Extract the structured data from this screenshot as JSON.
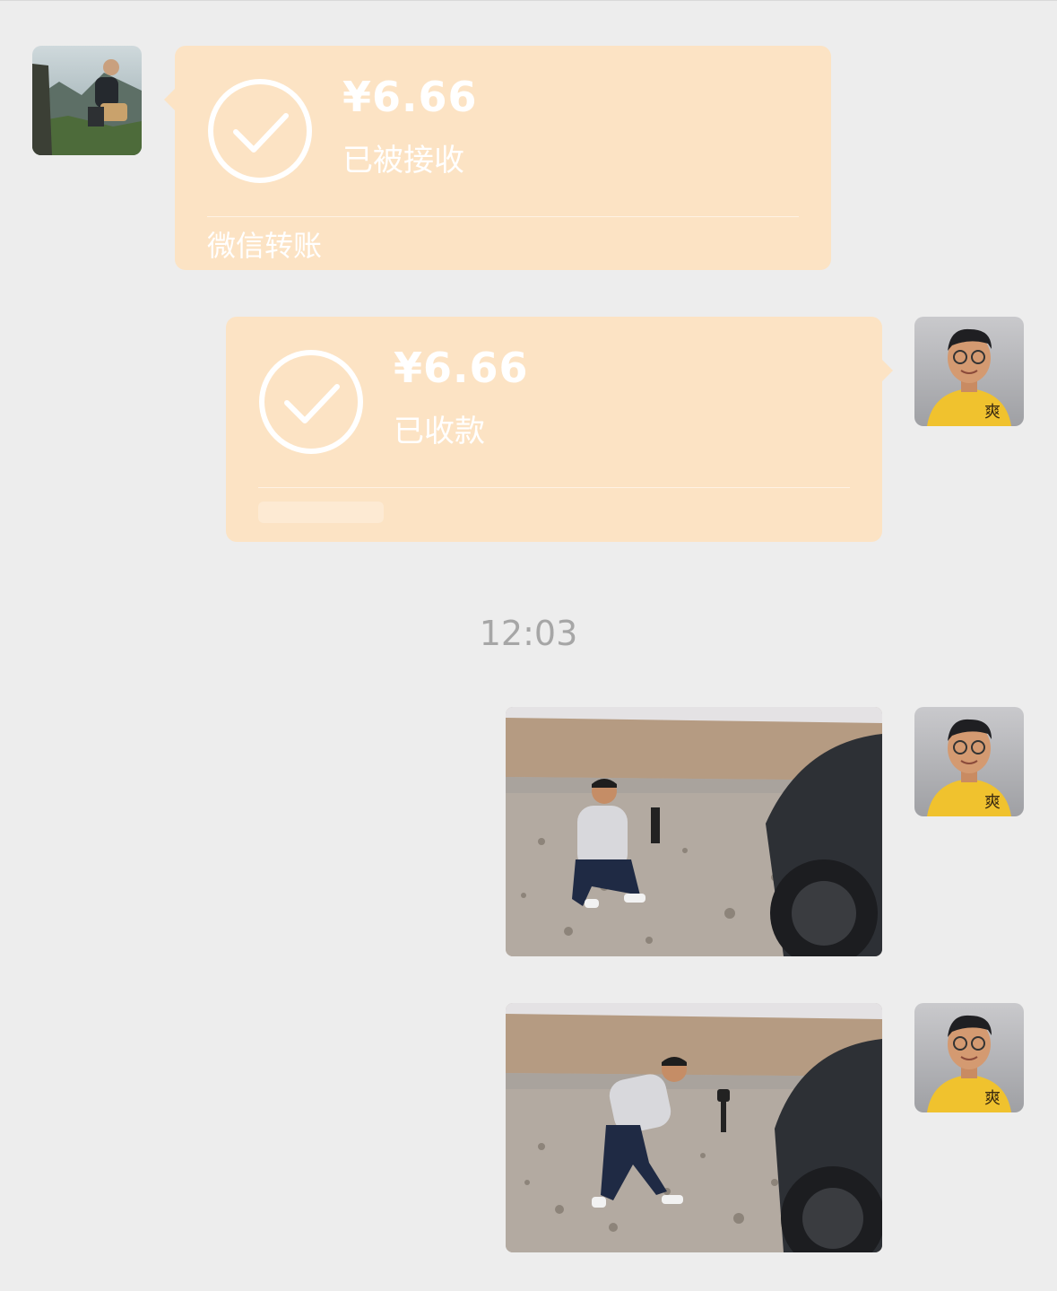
{
  "messages": [
    {
      "type": "transfer",
      "side": "left",
      "amount": "¥6.66",
      "status": "已被接收",
      "footer": "微信转账",
      "icon": "check-circle-icon"
    },
    {
      "type": "transfer",
      "side": "right",
      "amount": "¥6.66",
      "status": "已收款",
      "footer": "",
      "icon": "check-circle-icon"
    }
  ],
  "timestamp": "12:03",
  "colors": {
    "background": "#ededed",
    "transfer_bubble": "#fce3c4",
    "timestamp_text": "#a6a6a6"
  }
}
